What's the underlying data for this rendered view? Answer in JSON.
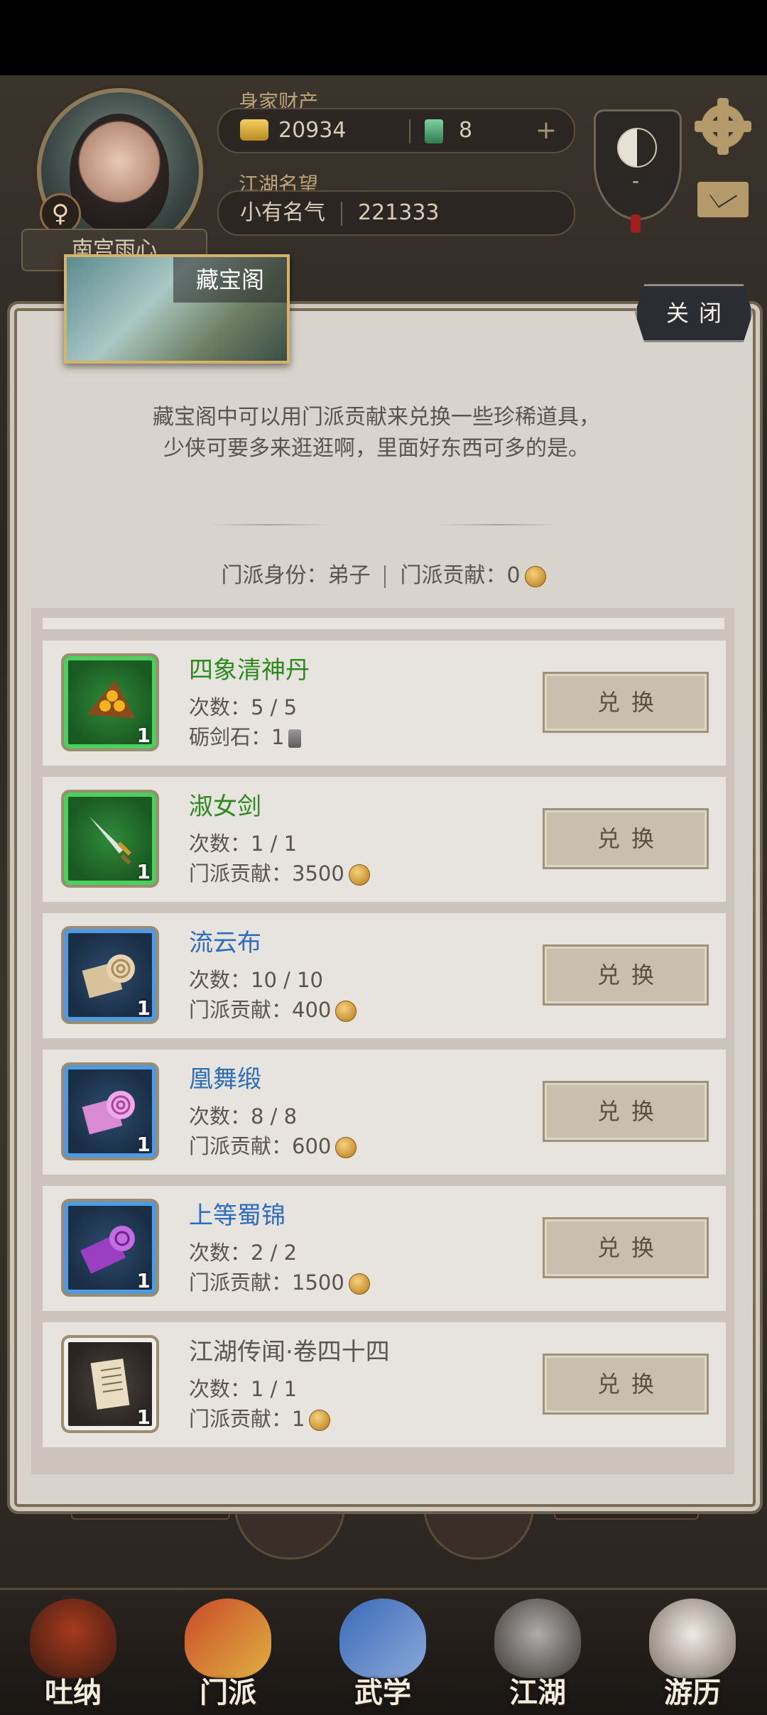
{
  "header": {
    "wealth_label": "身家财产",
    "gold_amount": "20934",
    "jade_amount": "8",
    "plus_symbol": "+",
    "fame_label": "江湖名望",
    "fame_title": "小有名气",
    "fame_value": "221333",
    "player_name": "南宫雨心",
    "gender_symbol": "♀",
    "taiji_level": "-"
  },
  "panel": {
    "title": "藏宝阁",
    "close_label": "关闭",
    "intro_line1": "藏宝阁中可以用门派贡献来兑换一些珍稀道具，",
    "intro_line2": "少侠可要多来逛逛啊，里面好东西可多的是。",
    "identity_label": "门派身份：弟子",
    "contribution_label": "门派贡献：0"
  },
  "items": [
    {
      "name": "四象清神丹",
      "rarity": "green",
      "qty": "1",
      "line1": "次数：5 / 5",
      "line2": "砺剑石：1",
      "cost_icon": "whetstone-icon",
      "button": "兑换",
      "icon": "pill-tray-icon"
    },
    {
      "name": "淑女剑",
      "rarity": "green",
      "qty": "1",
      "line1": "次数：1 / 1",
      "line2": "门派贡献：3500",
      "cost_icon": "contribution-coin-icon",
      "button": "兑换",
      "icon": "sword-icon"
    },
    {
      "name": "流云布",
      "rarity": "blue",
      "qty": "1",
      "line1": "次数：10 / 10",
      "line2": "门派贡献：400",
      "cost_icon": "contribution-coin-icon",
      "button": "兑换",
      "icon": "cloth-roll-tan-icon"
    },
    {
      "name": "凰舞缎",
      "rarity": "blue",
      "qty": "1",
      "line1": "次数：8 / 8",
      "line2": "门派贡献：600",
      "cost_icon": "contribution-coin-icon",
      "button": "兑换",
      "icon": "silk-roll-pink-icon"
    },
    {
      "name": "上等蜀锦",
      "rarity": "blue",
      "qty": "1",
      "line1": "次数：2 / 2",
      "line2": "门派贡献：1500",
      "cost_icon": "contribution-coin-icon",
      "button": "兑换",
      "icon": "brocade-roll-purple-icon"
    },
    {
      "name": "江湖传闻·卷四十四",
      "rarity": "white",
      "qty": "1",
      "line1": "次数：1 / 1",
      "line2": "门派贡献：1",
      "cost_icon": "contribution-coin-icon",
      "button": "兑换",
      "icon": "scroll-paper-icon"
    }
  ],
  "bottom_nav": [
    {
      "label": "吐纳",
      "icon": "meditation-figure-icon"
    },
    {
      "label": "门派",
      "icon": "sect-banner-icon"
    },
    {
      "label": "武学",
      "icon": "martial-books-icon"
    },
    {
      "label": "江湖",
      "icon": "bamboo-hat-icon"
    },
    {
      "label": "游历",
      "icon": "white-horse-icon"
    }
  ],
  "colors": {
    "green_name": "#2c8a1f",
    "blue_name": "#2c6dbd",
    "panel_bg": "#d9d3cd",
    "button_bg": "#c9bfae"
  }
}
